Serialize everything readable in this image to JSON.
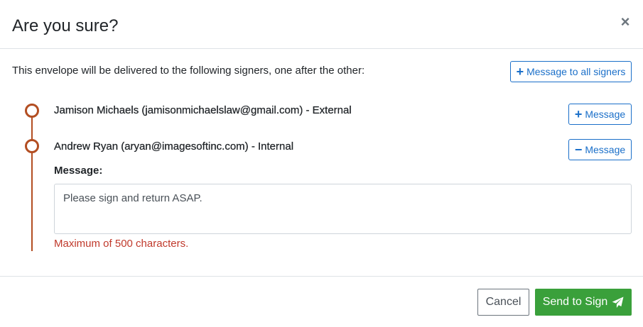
{
  "dialog": {
    "title": "Are you sure?",
    "close_symbol": "×",
    "close_icon": "close-icon"
  },
  "intro": {
    "text": "This envelope will be delivered to the following signers, one after the other:"
  },
  "message_all_button": {
    "symbol": "+",
    "label": "Message to all signers"
  },
  "signers": [
    {
      "text": "Jamison Michaels (jamisonmichaelslaw@gmail.com) - External",
      "button_symbol": "+",
      "button_label": "Message"
    },
    {
      "text": "Andrew Ryan (aryan@imagesoftinc.com) - Internal",
      "button_symbol": "−",
      "button_label": "Message",
      "message_label": "Message:",
      "message_value": "Please sign and return ASAP.",
      "limit_text": "Maximum of 500 characters."
    }
  ],
  "footer": {
    "cancel_label": "Cancel",
    "send_label": "Send to Sign",
    "send_icon": "paper-plane-icon"
  },
  "colors": {
    "accent_blue": "#1a6fc9",
    "timeline": "#b34e22",
    "send_green": "#3aa03b",
    "error_red": "#c0392b"
  }
}
